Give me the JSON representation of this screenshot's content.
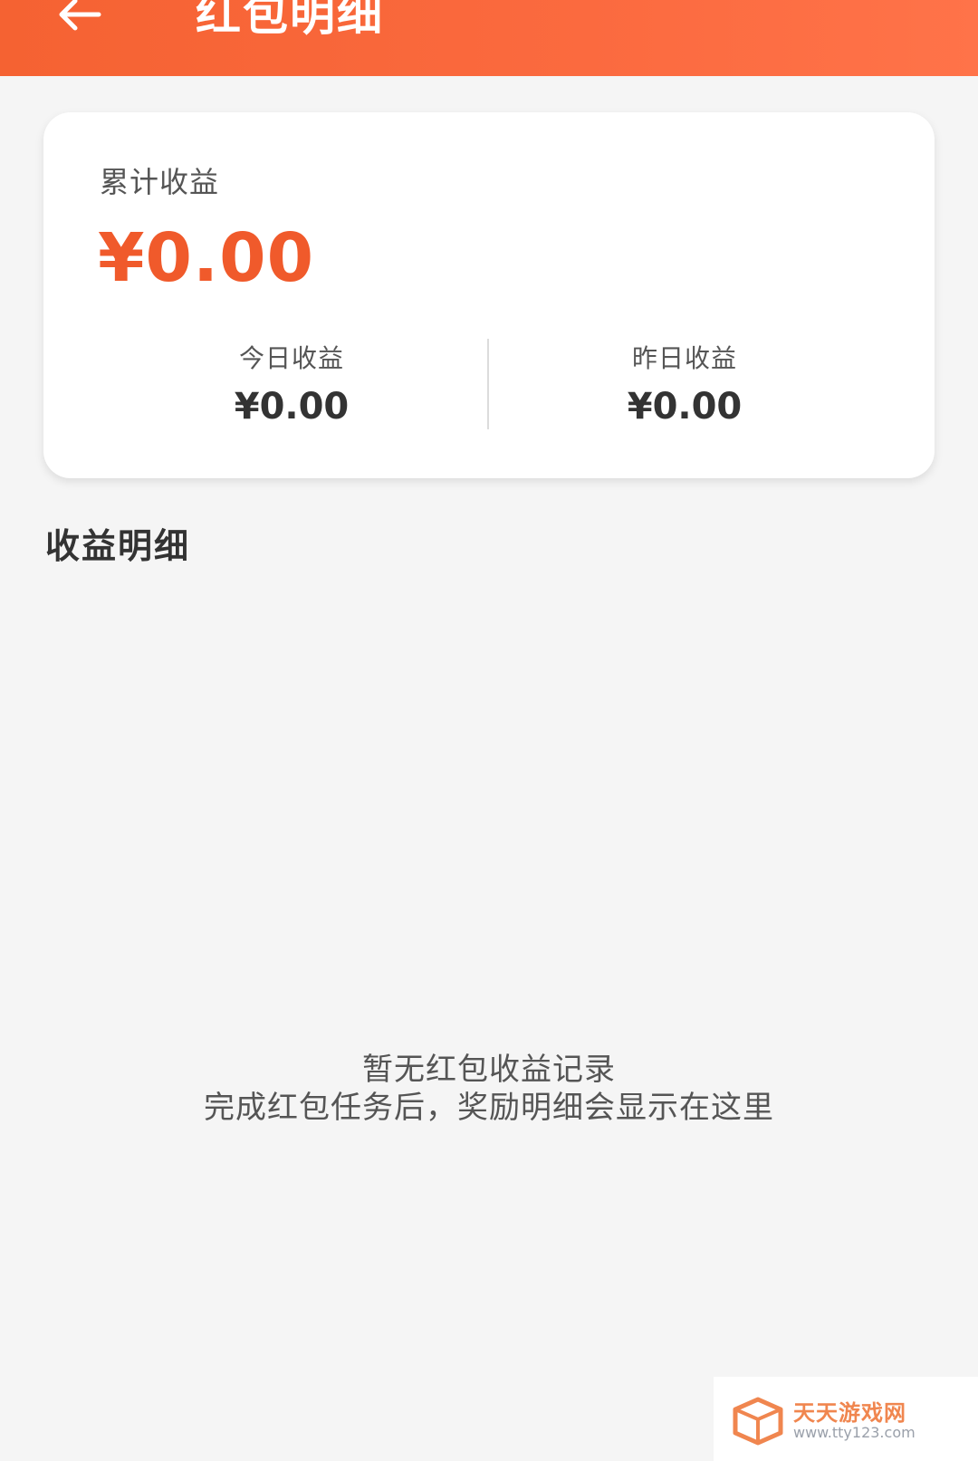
{
  "header": {
    "back_icon": "arrow-left-icon",
    "title": "红包明细",
    "color": "#f56232"
  },
  "summary": {
    "total_label": "累计收益",
    "total_amount": "¥0.00",
    "today_label": "今日收益",
    "today_amount": "¥0.00",
    "yesterday_label": "昨日收益",
    "yesterday_amount": "¥0.00",
    "accent": "#f05a2b"
  },
  "details": {
    "title": "收益明细",
    "empty_line1": "暂无红包收益记录",
    "empty_line2": "完成红包任务后，奖励明细会显示在这里"
  },
  "watermark": {
    "name": "天天游戏网",
    "url": "www.tty123.com"
  }
}
